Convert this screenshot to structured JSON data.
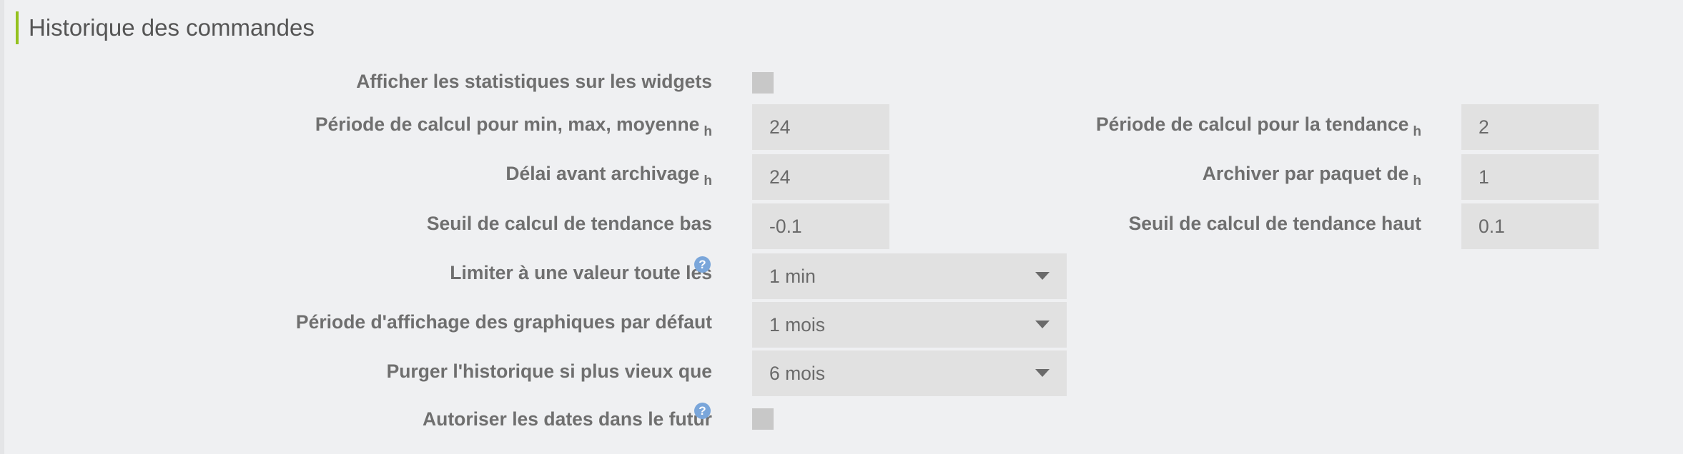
{
  "section": {
    "title": "Historique des commandes",
    "accent_color": "#94c11f"
  },
  "help_icon_glyph": "?",
  "fields": {
    "show_stats": {
      "label": "Afficher les statistiques sur les widgets",
      "checked": false
    },
    "minmax_period": {
      "label": "Période de calcul pour min, max, moyenne",
      "unit": "h",
      "value": "24"
    },
    "trend_period": {
      "label": "Période de calcul pour la tendance",
      "unit": "h",
      "value": "2"
    },
    "archive_delay": {
      "label": "Délai avant archivage",
      "unit": "h",
      "value": "24"
    },
    "archive_packet": {
      "label": "Archiver par paquet de",
      "unit": "h",
      "value": "1"
    },
    "trend_low": {
      "label": "Seuil de calcul de tendance bas",
      "value": "-0.1"
    },
    "trend_high": {
      "label": "Seuil de calcul de tendance haut",
      "value": "0.1"
    },
    "limit_value": {
      "label": "Limiter à une valeur toute les",
      "selected": "1 min",
      "help_icon": "question-circle-icon"
    },
    "graph_period": {
      "label": "Période d'affichage des graphiques par défaut",
      "selected": "1 mois"
    },
    "purge_history": {
      "label": "Purger l'historique si plus vieux que",
      "selected": "6 mois"
    },
    "allow_future": {
      "label": "Autoriser les dates dans le futur",
      "checked": false,
      "help_icon": "question-circle-icon"
    }
  }
}
